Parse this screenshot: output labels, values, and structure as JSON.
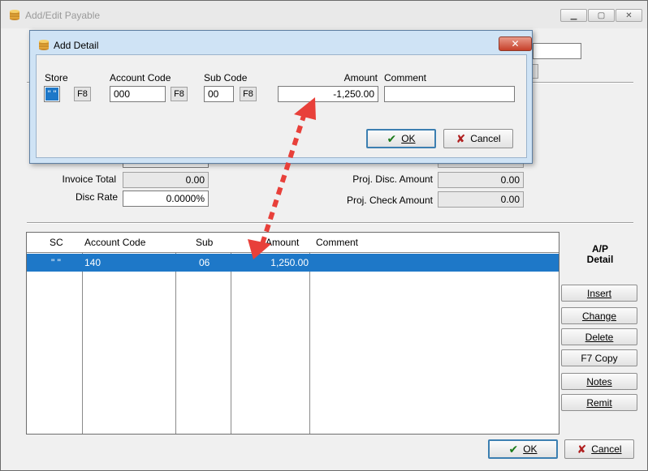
{
  "main": {
    "title": "Add/Edit Payable",
    "totals": {
      "invoice_total_label": "Invoice Total",
      "invoice_total_value": "0.00",
      "disc_rate_label": "Disc Rate",
      "disc_rate_value": "0.0000%",
      "proj_disc_label": "Proj. Disc. Amount",
      "proj_disc_value": "0.00",
      "proj_check_label": "Proj. Check Amount",
      "proj_check_value": "0.00"
    },
    "grid": {
      "headers": [
        "SC",
        "Account Code",
        "Sub",
        "Amount",
        "Comment"
      ],
      "rows": [
        [
          "\" \"",
          "140",
          "06",
          "1,250.00",
          ""
        ]
      ]
    },
    "side": {
      "title_line1": "A/P",
      "title_line2": "Detail",
      "insert": "Insert",
      "change": "Change",
      "delete": "Delete",
      "copy": "F7 Copy",
      "notes": "Notes",
      "remit": "Remit"
    },
    "ok": "OK",
    "cancel": "Cancel"
  },
  "dialog": {
    "title": "Add Detail",
    "close_glyph": "✕",
    "store_label": "Store",
    "store_value": "\" \"",
    "account_label": "Account Code",
    "account_value": "000",
    "sub_label": "Sub Code",
    "sub_value": "00",
    "amount_label": "Amount",
    "amount_value": "-1,250.00",
    "comment_label": "Comment",
    "comment_value": "",
    "f8": "F8",
    "ok": "OK",
    "cancel": "Cancel"
  },
  "colors": {
    "selection": "#1e78c8",
    "dialog_frame": "#cfe3f5",
    "annotation_arrow": "#e8403a"
  },
  "icons": {
    "app": "coins-stack-icon",
    "ok": "check-icon",
    "cancel": "x-icon"
  }
}
